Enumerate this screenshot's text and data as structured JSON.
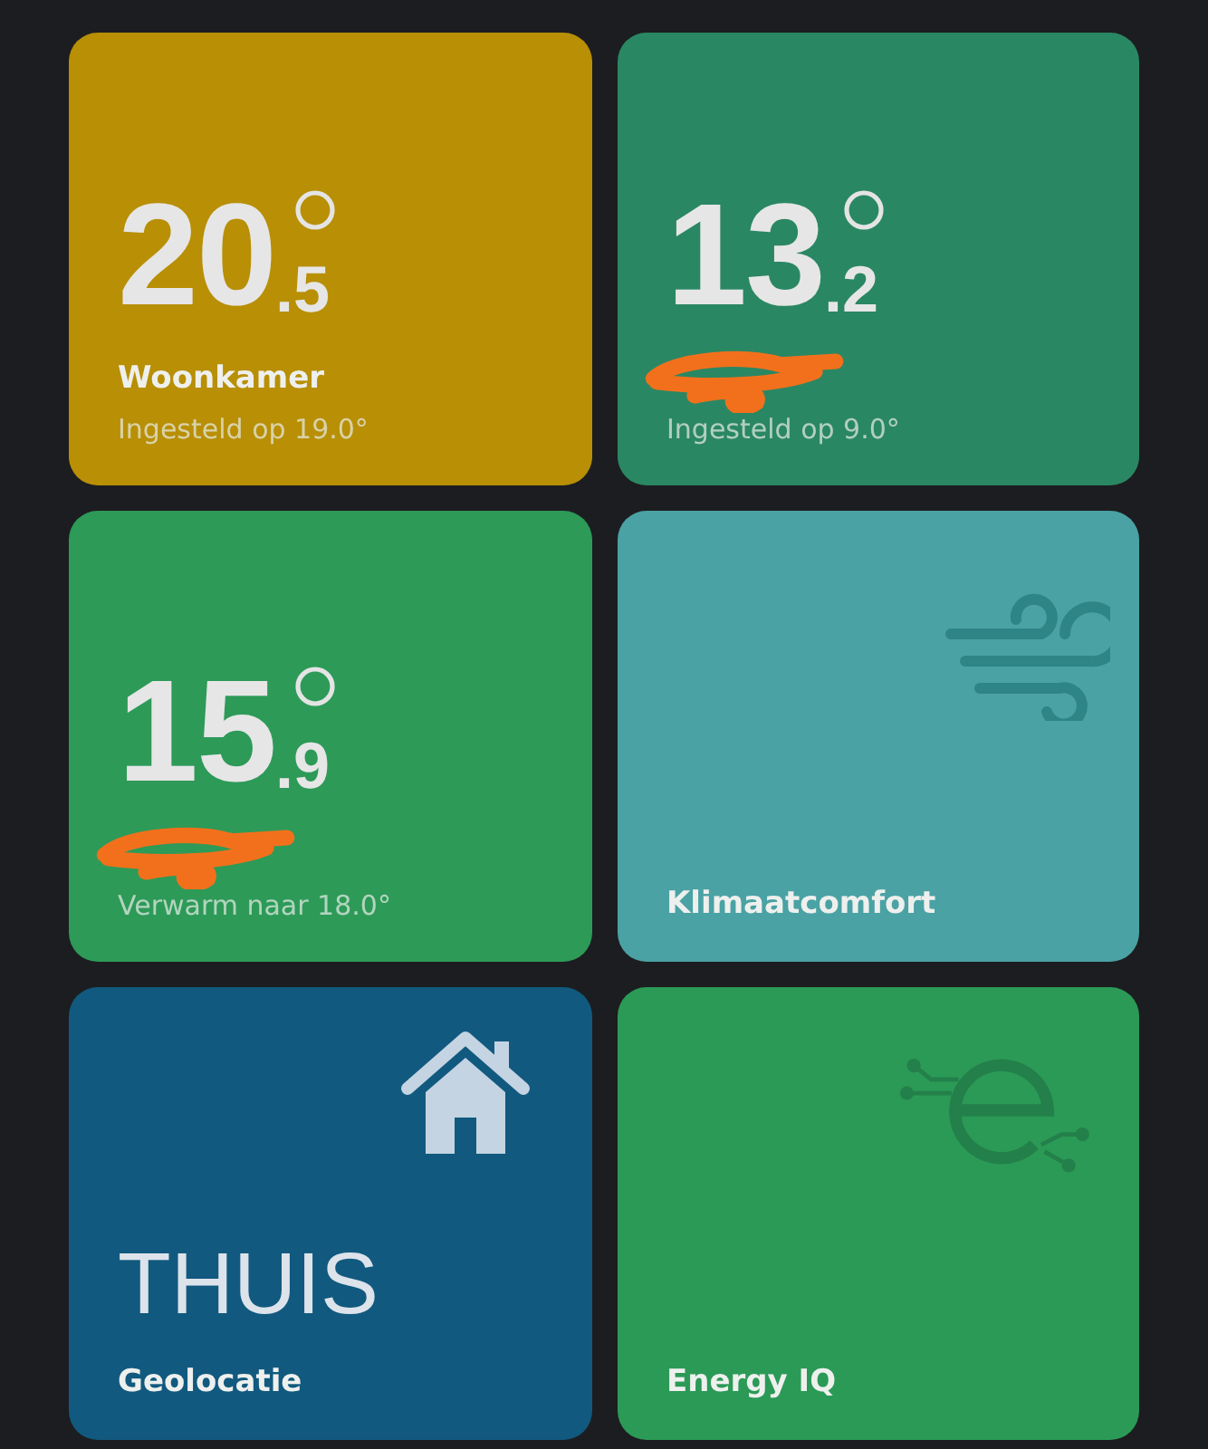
{
  "tiles": [
    {
      "kind": "thermostat",
      "color": "#b88f05",
      "whole": "20",
      "decimal": ".5",
      "redacted": false,
      "name": "Woonkamer",
      "status": "Ingesteld op 19.0°"
    },
    {
      "kind": "thermostat",
      "color": "#2a8763",
      "whole": "13",
      "decimal": ".2",
      "redacted": true,
      "status": "Ingesteld op 9.0°"
    },
    {
      "kind": "thermostat",
      "color": "#2d9a58",
      "whole": "15",
      "decimal": ".9",
      "redacted": true,
      "status": "Verwarm naar 18.0°"
    },
    {
      "kind": "climate",
      "color": "#4aa2a4",
      "name": "Klimaatcomfort"
    },
    {
      "kind": "presence",
      "color": "#11597f",
      "value": "THUIS",
      "name": "Geolocatie"
    },
    {
      "kind": "energy",
      "color": "#2b9a56",
      "name": "Energy IQ"
    }
  ]
}
